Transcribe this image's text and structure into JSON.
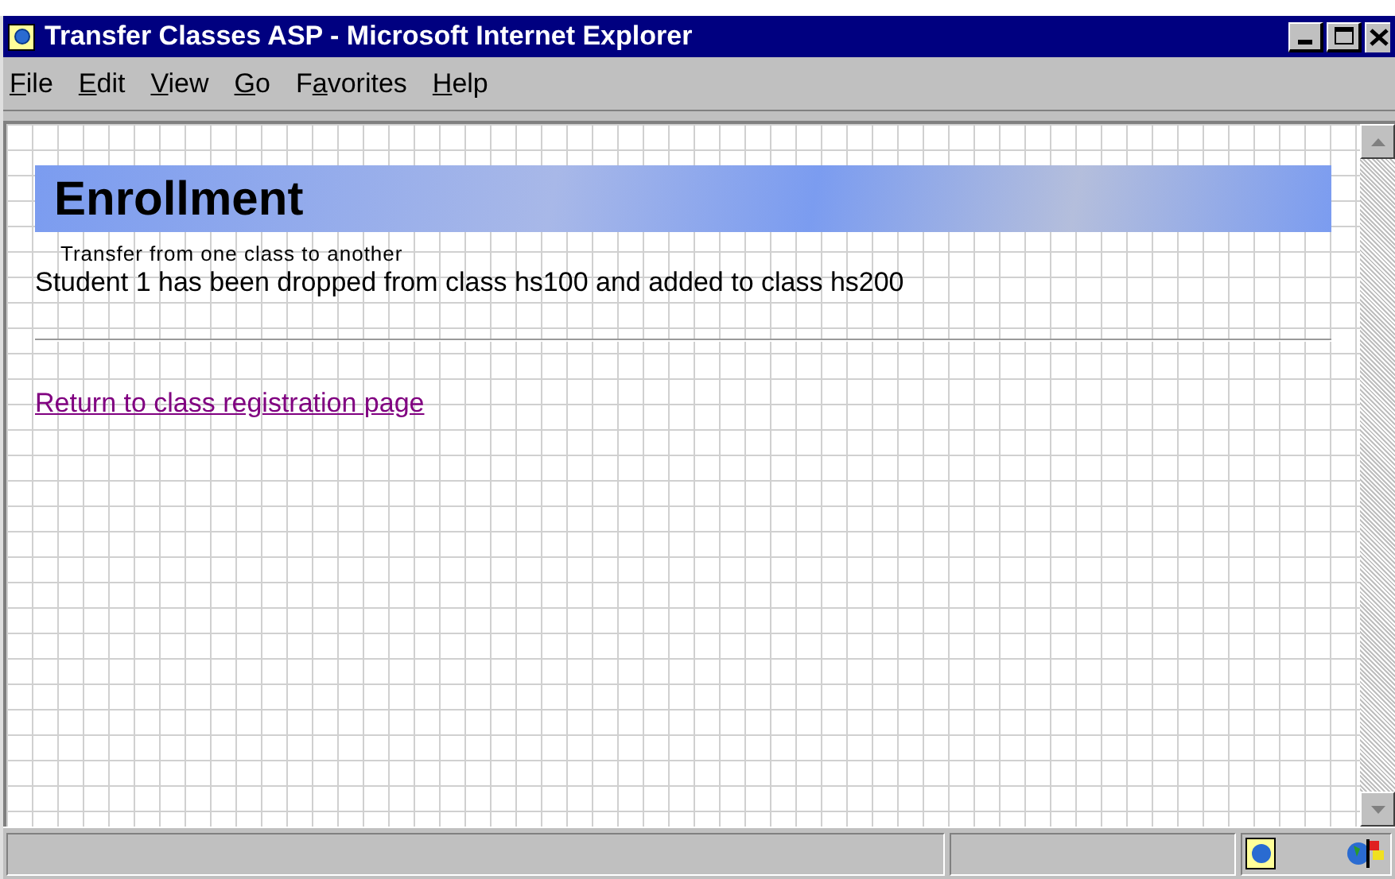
{
  "window": {
    "title": "Transfer Classes ASP - Microsoft Internet Explorer"
  },
  "menu": [
    {
      "accel": "F",
      "rest": "ile"
    },
    {
      "accel": "E",
      "rest": "dit"
    },
    {
      "accel": "V",
      "rest": "iew"
    },
    {
      "accel": "G",
      "rest": "o"
    },
    {
      "pre": "F",
      "accel": "a",
      "rest": "vorites"
    },
    {
      "accel": "H",
      "rest": "elp"
    }
  ],
  "page": {
    "banner": "Enrollment",
    "subtitle": "Transfer from one class to another",
    "message": "Student 1 has been dropped from class hs100 and added to class hs200",
    "link": "Return to class registration page"
  }
}
